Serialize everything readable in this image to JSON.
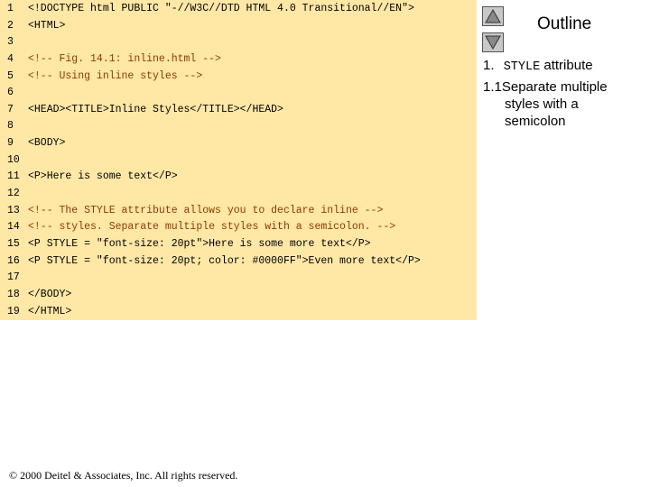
{
  "code_lines": [
    {
      "num": "1",
      "text": "<!DOCTYPE html PUBLIC \"-//W3C//DTD HTML 4.0 Transitional//EN\">"
    },
    {
      "num": "2",
      "text": "<HTML>"
    },
    {
      "num": "3",
      "text": ""
    },
    {
      "num": "4",
      "text": "<!-- Fig. 14.1: inline.html -->"
    },
    {
      "num": "5",
      "text": "<!-- Using inline styles -->"
    },
    {
      "num": "6",
      "text": ""
    },
    {
      "num": "7",
      "text": "<HEAD><TITLE>Inline Styles</TITLE></HEAD>"
    },
    {
      "num": "8",
      "text": ""
    },
    {
      "num": "9",
      "text": "<BODY>"
    },
    {
      "num": "10",
      "text": ""
    },
    {
      "num": "11",
      "text": "<P>Here is some text</P>"
    },
    {
      "num": "12",
      "text": ""
    },
    {
      "num": "13",
      "text": "<!-- The STYLE attribute allows you to declare inline -->"
    },
    {
      "num": "14",
      "text": "<!-- styles. Separate multiple styles with a semicolon. -->"
    },
    {
      "num": "15",
      "text": "<P STYLE = \"font-size: 20pt\">Here is some more text</P>"
    },
    {
      "num": "16",
      "text": "<P STYLE = \"font-size: 20pt; color: #0000FF\">Even more text</P>"
    },
    {
      "num": "17",
      "text": ""
    },
    {
      "num": "18",
      "text": "</BODY>"
    },
    {
      "num": "19",
      "text": "</HTML>"
    }
  ],
  "outline": {
    "title": "Outline",
    "item1_num": "1.",
    "item1_code": "STYLE",
    "item1_text": "attribute",
    "item2_num": "1.1",
    "item2_text_line1": "Separate multiple",
    "item2_text_line2": "styles with a",
    "item2_text_line3": "semicolon"
  },
  "nav": {
    "up_icon": "triangle-up-icon",
    "down_icon": "triangle-down-icon"
  },
  "footer": {
    "text": "© 2000 Deitel & Associates, Inc.  All rights reserved."
  },
  "colors": {
    "code_background": "#ffe7a6",
    "comment_color": "#8b3a00"
  }
}
